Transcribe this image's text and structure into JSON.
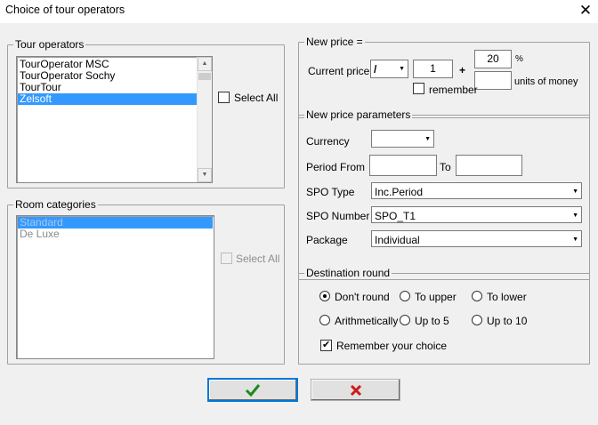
{
  "window": {
    "title": "Choice of tour operators",
    "close_glyph": "✕"
  },
  "tour_operators": {
    "legend": "Tour operators",
    "items": [
      {
        "label": "TourOperator MSC",
        "selected": false
      },
      {
        "label": "TourOperator Sochy",
        "selected": false
      },
      {
        "label": "TourTour",
        "selected": false
      },
      {
        "label": "Zelsoft",
        "selected": true
      }
    ],
    "select_all_label": "Select All",
    "select_all_checked": false
  },
  "room_categories": {
    "legend": "Room categories",
    "items": [
      {
        "label": "Standard",
        "selected": true
      },
      {
        "label": "De Luxe",
        "selected": false
      }
    ],
    "select_all_label": "Select All",
    "select_all_checked": false
  },
  "new_price": {
    "legend": "New price =",
    "current_price_label": "Current price",
    "operator_value": "/",
    "factor_value": "1",
    "plus_sign": "+",
    "percent_value": "20",
    "percent_sign": "%",
    "units_value": "",
    "units_label": "units of money",
    "remember_label": "remember",
    "remember_checked": false
  },
  "params": {
    "legend": "New price parameters",
    "currency_label": "Currency",
    "currency_value": "",
    "period_label": "Period  From",
    "period_from": "",
    "to_label": "To",
    "period_to": "",
    "spo_type_label": "SPO Type",
    "spo_type_value": "Inc.Period",
    "spo_number_label": "SPO Number",
    "spo_number_value": "SPO_T1",
    "package_label": "Package",
    "package_value": "Individual"
  },
  "destination_round": {
    "legend": "Destination round",
    "options": [
      {
        "label": "Don't round",
        "selected": true
      },
      {
        "label": "To upper",
        "selected": false
      },
      {
        "label": "To lower",
        "selected": false
      },
      {
        "label": "Arithmetically",
        "selected": false
      },
      {
        "label": "Up to 5",
        "selected": false
      },
      {
        "label": "Up to 10",
        "selected": false
      }
    ],
    "remember_label": "Remember your choice",
    "remember_checked": true
  },
  "buttons": {
    "ok_icon": "check-icon",
    "cancel_icon": "cross-icon"
  },
  "colors": {
    "ok_green": "#1a8a1a",
    "cancel_red": "#d01818",
    "selection": "#3399ff"
  }
}
